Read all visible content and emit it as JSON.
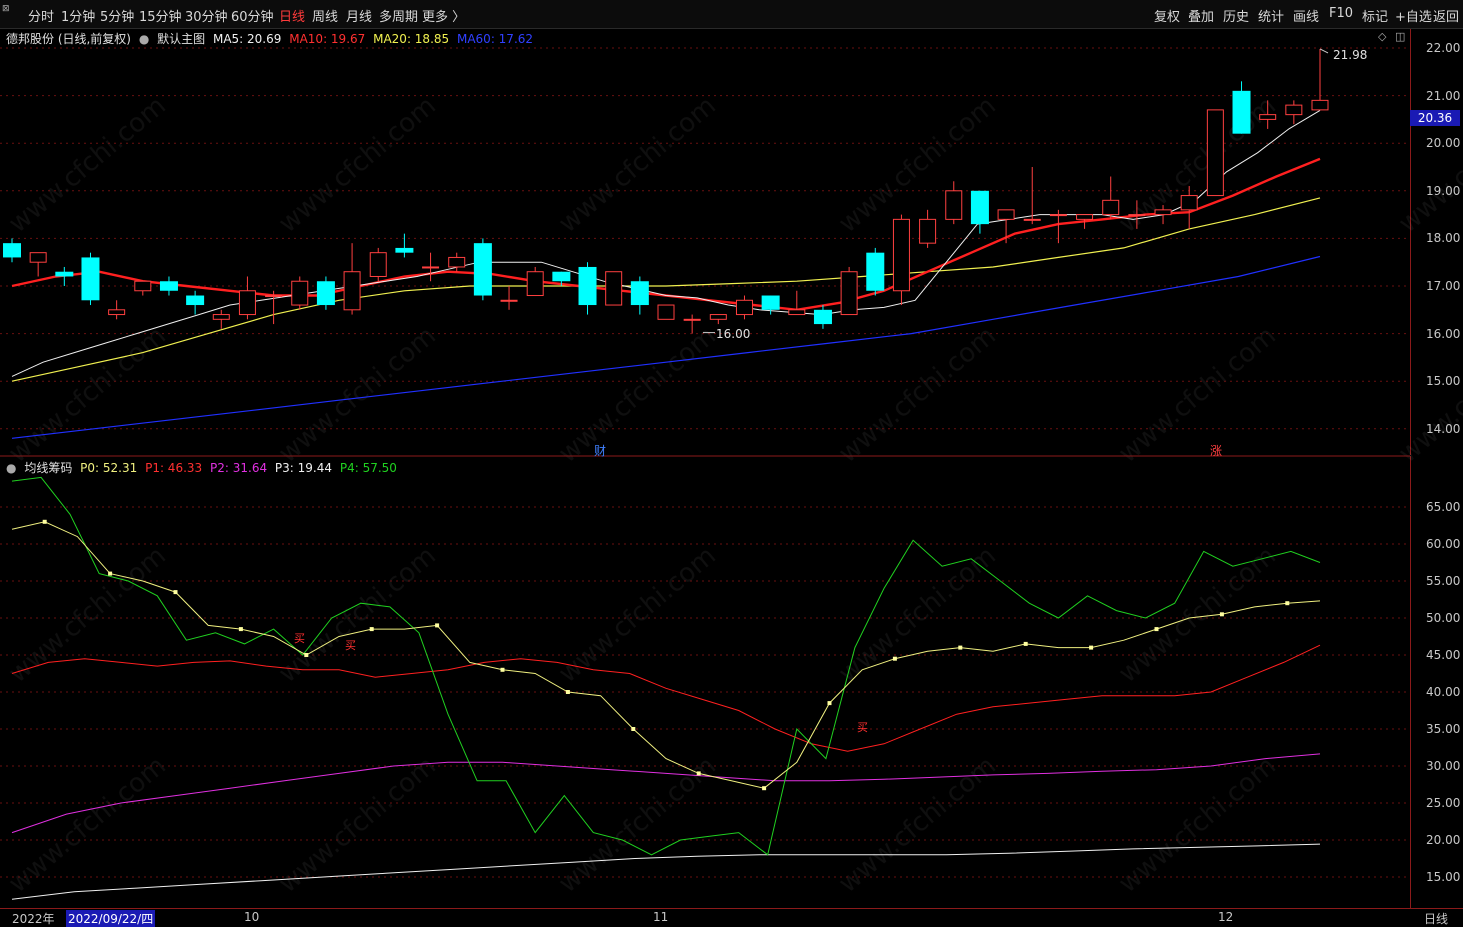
{
  "toolbar": {
    "left": [
      "分时",
      "1分钟",
      "5分钟",
      "15分钟",
      "30分钟",
      "60分钟",
      "日线",
      "周线",
      "月线",
      "多周期",
      "更多 〉"
    ],
    "active": "日线",
    "right": [
      "复权",
      "叠加",
      "历史",
      "统计",
      "画线",
      "F10",
      "标记",
      "+自选",
      "返回"
    ]
  },
  "main_info": {
    "stock": "德邦股份 (日线,前复权)",
    "template": "默认主图",
    "ma5": "MA5: 20.69",
    "ma10": "MA10: 19.67",
    "ma20": "MA20: 18.85",
    "ma60": "MA60: 17.62"
  },
  "sub_info": {
    "name": "均线筹码",
    "p0": "P0: 52.31",
    "p1": "P1: 46.33",
    "p2": "P2: 31.64",
    "p3": "P3: 19.44",
    "p4": "P4: 57.50"
  },
  "colors": {
    "ma5": "#f0f0f0",
    "ma10": "#ff2020",
    "ma20": "#f0f050",
    "ma60": "#2030ff",
    "up": "#ff4040",
    "down": "#00ffff",
    "p0": "#f0f080",
    "p1": "#ff2020",
    "p2": "#e030e0",
    "p3": "#f0f0f0",
    "p4": "#20d020"
  },
  "price_axis": [
    "22.00",
    "21.00",
    "20.00",
    "19.00",
    "18.00",
    "17.00",
    "16.00",
    "15.00",
    "14.00"
  ],
  "current_price": "20.36",
  "sub_axis": [
    "65.00",
    "60.00",
    "55.00",
    "50.00",
    "45.00",
    "40.00",
    "35.00",
    "30.00",
    "25.00",
    "20.00",
    "15.00"
  ],
  "annotations": {
    "high": "21.98",
    "low": "16.00",
    "cai": "财",
    "zhang": "涨",
    "buy": "买"
  },
  "dates": {
    "year": "2022年",
    "selected": "2022/09/22/四",
    "oct": "10",
    "nov": "11",
    "dec": "12",
    "period": "日线"
  },
  "watermark": "www.cfchi.com",
  "chart_data": {
    "type": "candlestick",
    "candles": [
      [
        17.9,
        17.6,
        18.0,
        17.5
      ],
      [
        17.5,
        17.7,
        17.7,
        17.2
      ],
      [
        17.3,
        17.2,
        17.4,
        17.0
      ],
      [
        17.6,
        16.7,
        17.7,
        16.6
      ],
      [
        16.4,
        16.5,
        16.7,
        16.3
      ],
      [
        16.9,
        17.1,
        17.1,
        16.8
      ],
      [
        17.1,
        16.9,
        17.2,
        16.8
      ],
      [
        16.8,
        16.6,
        16.9,
        16.4
      ],
      [
        16.3,
        16.4,
        16.5,
        16.1
      ],
      [
        16.4,
        16.9,
        17.2,
        16.3
      ],
      [
        16.8,
        16.8,
        16.9,
        16.2
      ],
      [
        16.6,
        17.1,
        17.2,
        16.5
      ],
      [
        17.1,
        16.6,
        17.2,
        16.5
      ],
      [
        16.5,
        17.3,
        17.9,
        16.4
      ],
      [
        17.2,
        17.7,
        17.8,
        17.1
      ],
      [
        17.8,
        17.7,
        18.1,
        17.6
      ],
      [
        17.4,
        17.4,
        17.7,
        17.1
      ],
      [
        17.4,
        17.6,
        17.7,
        17.3
      ],
      [
        17.9,
        16.8,
        18.0,
        16.7
      ],
      [
        16.7,
        16.7,
        17.0,
        16.5
      ],
      [
        16.8,
        17.3,
        17.4,
        16.8
      ],
      [
        17.3,
        17.1,
        17.3,
        17.0
      ],
      [
        17.4,
        16.6,
        17.5,
        16.4
      ],
      [
        16.6,
        17.3,
        17.3,
        16.6
      ],
      [
        17.1,
        16.6,
        17.2,
        16.4
      ],
      [
        16.3,
        16.6,
        16.6,
        16.3
      ],
      [
        16.3,
        16.3,
        16.4,
        16.0
      ],
      [
        16.3,
        16.4,
        16.4,
        16.2
      ],
      [
        16.4,
        16.7,
        16.8,
        16.3
      ],
      [
        16.8,
        16.5,
        16.8,
        16.4
      ],
      [
        16.4,
        16.5,
        16.9,
        16.4
      ],
      [
        16.5,
        16.2,
        16.6,
        16.1
      ],
      [
        16.4,
        17.3,
        17.4,
        16.4
      ],
      [
        17.7,
        16.9,
        17.8,
        16.8
      ],
      [
        16.9,
        18.4,
        18.5,
        16.6
      ],
      [
        17.9,
        18.4,
        18.6,
        17.8
      ],
      [
        18.4,
        19.0,
        19.2,
        18.3
      ],
      [
        19.0,
        18.3,
        19.0,
        18.1
      ],
      [
        18.4,
        18.6,
        18.6,
        17.9
      ],
      [
        18.4,
        18.4,
        19.5,
        18.3
      ],
      [
        18.5,
        18.5,
        18.6,
        17.9
      ],
      [
        18.4,
        18.5,
        18.5,
        18.2
      ],
      [
        18.5,
        18.8,
        19.3,
        18.4
      ],
      [
        18.5,
        18.5,
        18.8,
        18.2
      ],
      [
        18.5,
        18.6,
        18.7,
        18.3
      ],
      [
        18.6,
        18.9,
        19.1,
        18.2
      ],
      [
        18.9,
        20.7,
        20.7,
        18.9
      ],
      [
        21.1,
        20.2,
        21.3,
        20.2
      ],
      [
        20.5,
        20.6,
        20.9,
        20.3
      ],
      [
        20.6,
        20.8,
        20.9,
        20.4
      ],
      [
        20.7,
        20.9,
        21.98,
        20.7
      ]
    ],
    "ma5": [
      15.1,
      15.4,
      15.6,
      15.8,
      16.0,
      16.2,
      16.4,
      16.6,
      16.7,
      16.8,
      16.9,
      17.0,
      17.1,
      17.2,
      17.35,
      17.5,
      17.5,
      17.5,
      17.3,
      17.1,
      16.95,
      16.8,
      16.75,
      16.6,
      16.5,
      16.45,
      16.4,
      16.5,
      16.55,
      16.7,
      17.5,
      18.3,
      18.4,
      18.5,
      18.5,
      18.5,
      18.4,
      18.5,
      18.8,
      19.4,
      19.8,
      20.3,
      20.69
    ],
    "ma10": [
      17.0,
      17.2,
      17.3,
      17.1,
      17.0,
      16.9,
      16.8,
      16.8,
      17.0,
      17.2,
      17.3,
      17.25,
      17.1,
      17.0,
      16.9,
      16.8,
      16.7,
      16.6,
      16.5,
      16.65,
      16.9,
      17.3,
      17.7,
      18.1,
      18.3,
      18.4,
      18.5,
      18.55,
      18.9,
      19.3,
      19.67
    ],
    "ma20": [
      15.0,
      15.3,
      15.6,
      16.0,
      16.4,
      16.7,
      16.9,
      17.0,
      17.0,
      17.0,
      17.0,
      17.05,
      17.1,
      17.2,
      17.3,
      17.4,
      17.6,
      17.8,
      18.2,
      18.5,
      18.85
    ],
    "ma60": [
      13.8,
      14.0,
      14.2,
      14.4,
      14.6,
      14.8,
      15.0,
      15.2,
      15.4,
      15.6,
      15.8,
      16.0,
      16.3,
      16.6,
      16.9,
      17.2,
      17.62
    ],
    "sub_series": {
      "p0": [
        62,
        63,
        61,
        56,
        55,
        53.5,
        49,
        48.5,
        47.5,
        45,
        47.5,
        48.5,
        48.5,
        49,
        44,
        43,
        42.5,
        40,
        39.5,
        35,
        31,
        29,
        28,
        27,
        30.5,
        38.5,
        43,
        44.5,
        45.5,
        46,
        45.5,
        46.5,
        46,
        46,
        47,
        48.5,
        50,
        50.5,
        51.5,
        52,
        52.31
      ],
      "p1": [
        42.5,
        44,
        44.5,
        44,
        43.5,
        44,
        44.2,
        43.5,
        43,
        43,
        42,
        42.5,
        43,
        44,
        44.5,
        44,
        43,
        42.5,
        40.5,
        39,
        37.5,
        35,
        33,
        32,
        33,
        35,
        37,
        38,
        38.5,
        39,
        39.5,
        39.5,
        39.5,
        40,
        42,
        44,
        46.33
      ],
      "p2": [
        21,
        23.5,
        25,
        26,
        27,
        28,
        29,
        30,
        30.5,
        30.5,
        30,
        29.5,
        29,
        28.5,
        28,
        28,
        28.2,
        28.5,
        28.8,
        29,
        29.3,
        29.5,
        30,
        31,
        31.64
      ],
      "p3": [
        12,
        13,
        13.5,
        14,
        14.5,
        15,
        15.5,
        16,
        16.5,
        17,
        17.5,
        17.8,
        18,
        18,
        18,
        18,
        18.2,
        18.5,
        18.8,
        19,
        19.2,
        19.44
      ],
      "p4": [
        68.5,
        69,
        64,
        56,
        55,
        53,
        47,
        48,
        46.5,
        48.5,
        45,
        50,
        52,
        51.5,
        48,
        37,
        28,
        28,
        21,
        26,
        21,
        20,
        18,
        20,
        20.5,
        21,
        18,
        35,
        31,
        46,
        54,
        60.5,
        57,
        58,
        55,
        52,
        50,
        53,
        51,
        50,
        52,
        59,
        57,
        58,
        59,
        57.5
      ]
    }
  }
}
